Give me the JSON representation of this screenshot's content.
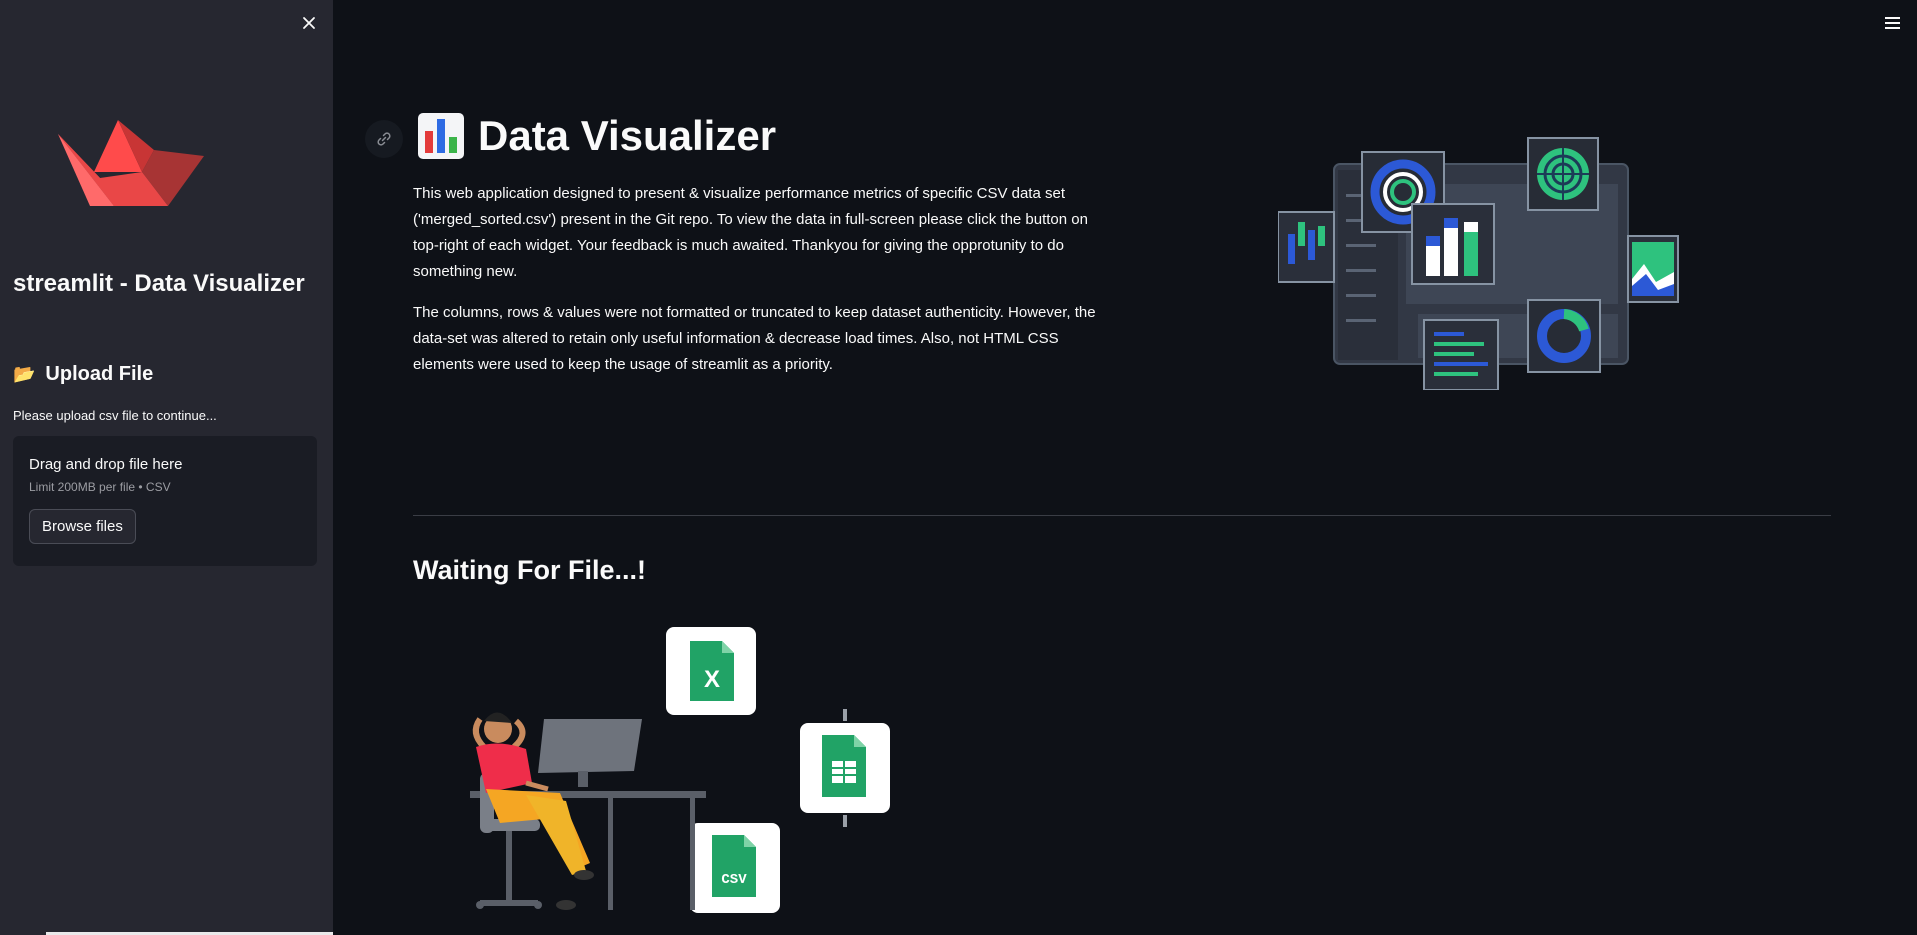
{
  "sidebar": {
    "title": "streamlit - Data Visualizer",
    "upload_header": "Upload File",
    "upload_emoji": "📂",
    "upload_hint": "Please upload csv file to continue...",
    "dropzone": {
      "title": "Drag and drop file here",
      "limit": "Limit 200MB per file • CSV",
      "browse_label": "Browse files"
    }
  },
  "main": {
    "title": "Data Visualizer",
    "description_1": "This web application designed to present & visualize performance metrics of specific CSV data set ('merged_sorted.csv') present in the Git repo. To view the data in full-screen please click the button on top-right of each widget. Your feedback is much awaited. Thankyou for giving the opprotunity to do something new.",
    "description_2": "The columns, rows & values were not formatted or truncated to keep dataset authenticity. However, the data-set was altered to retain only useful information & decrease load times. Also, not HTML CSS elements were used to keep the usage of streamlit as a priority.",
    "waiting_title": "Waiting For File...!"
  },
  "colors": {
    "background": "#0e1117",
    "sidebar": "#262730",
    "brand_red": "#ff4b4b",
    "text": "#fafafa"
  },
  "icons": [
    "close-icon",
    "hamburger-menu-icon",
    "link-icon",
    "bar-chart-emoji-icon",
    "folder-emoji-icon",
    "streamlit-logo"
  ]
}
